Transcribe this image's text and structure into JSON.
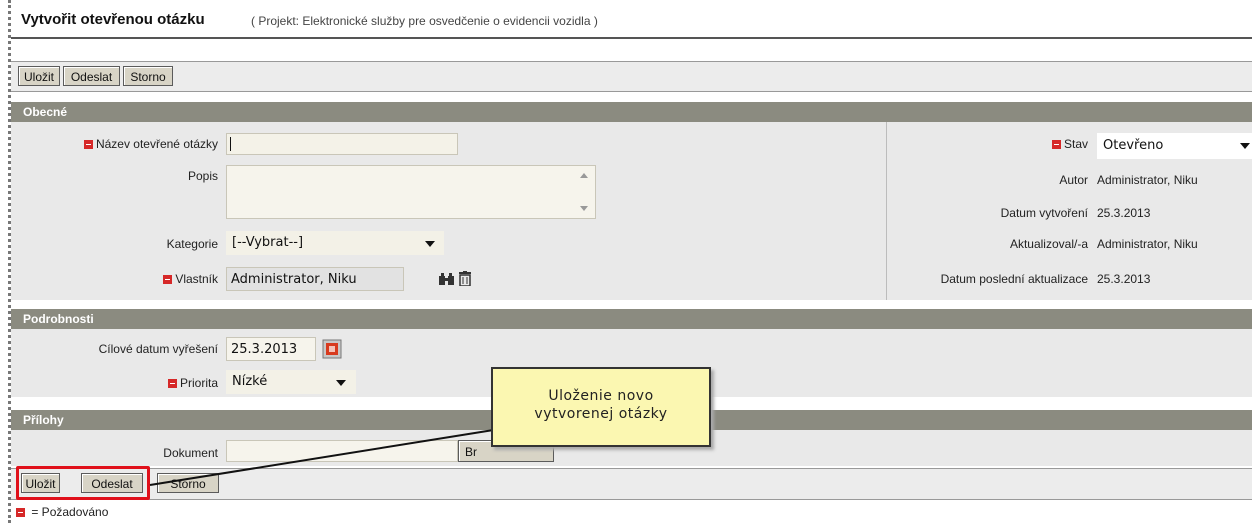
{
  "header": {
    "title": "Vytvořit otevřenou otázku",
    "subtitle": "( Projekt: Elektronické služby pre osvedčenie o evidencii vozidla )"
  },
  "toolbar": {
    "save_label": "Uložit",
    "send_label": "Odeslat",
    "cancel_label": "Storno"
  },
  "sections": {
    "general": "Obecné",
    "details": "Podrobnosti",
    "attachments": "Přílohy"
  },
  "general": {
    "name_label": "Název otevřené otázky",
    "name_value": "",
    "description_label": "Popis",
    "category_label": "Kategorie",
    "category_value": "[--Vybrat--]",
    "owner_label": "Vlastník",
    "owner_value": "Administrator, Niku",
    "status_label": "Stav",
    "status_value": "Otevřeno",
    "author_label": "Autor",
    "author_value": "Administrator, Niku",
    "created_label": "Datum vytvoření",
    "created_value": "25.3.2013",
    "updated_by_label": "Aktualizoval/-a",
    "updated_by_value": "Administrator, Niku",
    "last_update_label": "Datum poslední aktualizace",
    "last_update_value": "25.3.2013"
  },
  "details": {
    "target_date_label": "Cílové datum vyřešení",
    "target_date_value": "25.3.2013",
    "priority_label": "Priorita",
    "priority_value": "Nízké"
  },
  "attachments": {
    "document_label": "Dokument",
    "browse_label": "Br"
  },
  "callout": {
    "line1": "Uloženie novo",
    "line2": "vytvorenej otázky"
  },
  "footer": {
    "required_legend": "= Požadováno"
  },
  "colors": {
    "section_header": "#8b8b80",
    "required_marker": "#d62828",
    "callout_bg": "#fbf7b1",
    "highlight": "#e0101a"
  },
  "icons": [
    "required-icon",
    "search-binoculars-icon",
    "trash-icon",
    "calendar-icon",
    "scroll-up-icon",
    "scroll-down-icon",
    "dropdown-caret-icon"
  ]
}
